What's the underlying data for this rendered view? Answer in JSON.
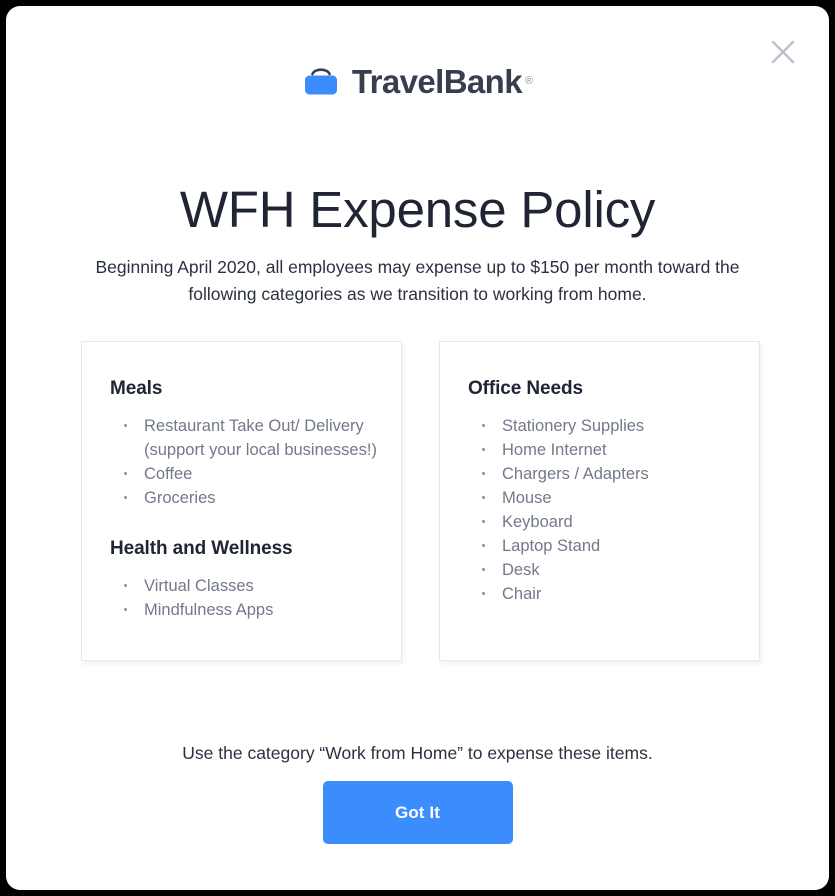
{
  "modal": {
    "close_icon": "close-icon",
    "accent_color": "#3b8cfc",
    "heading_color": "#1f2533",
    "body_color": "#72798a",
    "background_color": "#ffffff",
    "page_background": "#000000"
  },
  "brand": {
    "logo_icon": "briefcase-icon",
    "name": "TravelBank",
    "registered_mark": "®",
    "logo_icon_color": "#3b8cfc",
    "wordmark_color": "#373e4d"
  },
  "header": {
    "title": "WFH Expense Policy",
    "subtitle": "Beginning April 2020, all employees may expense up to $150 per month toward the following categories as we transition to working from home."
  },
  "cards": [
    {
      "card_name": "left-category-card",
      "sections": [
        {
          "heading": "Meals",
          "items": [
            "Restaurant Take Out/ Delivery (support your local businesses!)",
            "Coffee",
            "Groceries"
          ]
        },
        {
          "heading": "Health and Wellness",
          "items": [
            "Virtual Classes",
            "Mindfulness Apps"
          ]
        }
      ]
    },
    {
      "card_name": "right-category-card",
      "sections": [
        {
          "heading": "Office Needs",
          "items": [
            "Stationery Supplies",
            "Home Internet",
            "Chargers / Adapters",
            "Mouse",
            "Keyboard",
            "Laptop Stand",
            "Desk",
            "Chair"
          ]
        }
      ]
    }
  ],
  "footer": {
    "note": "Use the category “Work from Home” to expense these items.",
    "cta_label": "Got It"
  }
}
